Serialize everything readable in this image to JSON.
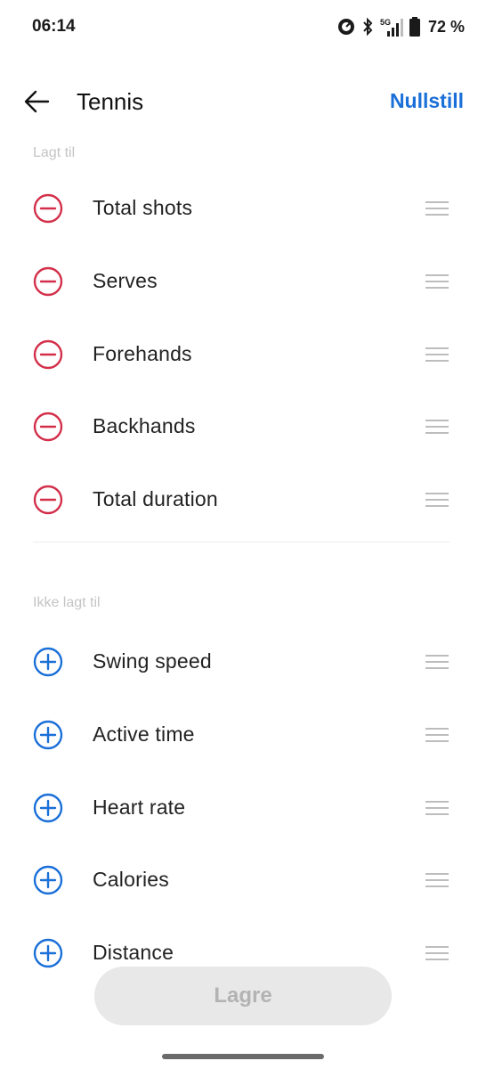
{
  "status_bar": {
    "time": "06:14",
    "battery": "72 %",
    "network": "5G"
  },
  "header": {
    "title": "Tennis",
    "reset_label": "Nullstill"
  },
  "added_section": {
    "label": "Lagt til",
    "items": [
      {
        "label": "Total shots"
      },
      {
        "label": "Serves"
      },
      {
        "label": "Forehands"
      },
      {
        "label": "Backhands"
      },
      {
        "label": "Total duration"
      }
    ]
  },
  "not_added_section": {
    "label": "Ikke lagt til",
    "items": [
      {
        "label": "Swing speed"
      },
      {
        "label": "Active time"
      },
      {
        "label": "Heart rate"
      },
      {
        "label": "Calories"
      },
      {
        "label": "Distance"
      }
    ]
  },
  "save_button": {
    "label": "Lagre"
  },
  "colors": {
    "accent": "#1a6fd8",
    "remove": "#d32f4a",
    "add": "#1a6fd8",
    "disabled_bg": "#e8e8e8",
    "disabled_text": "#b3b3b3"
  },
  "icons": {
    "back": "arrow-left-icon",
    "remove": "minus-circle-icon",
    "add": "plus-circle-icon",
    "drag": "drag-handle-icon"
  }
}
